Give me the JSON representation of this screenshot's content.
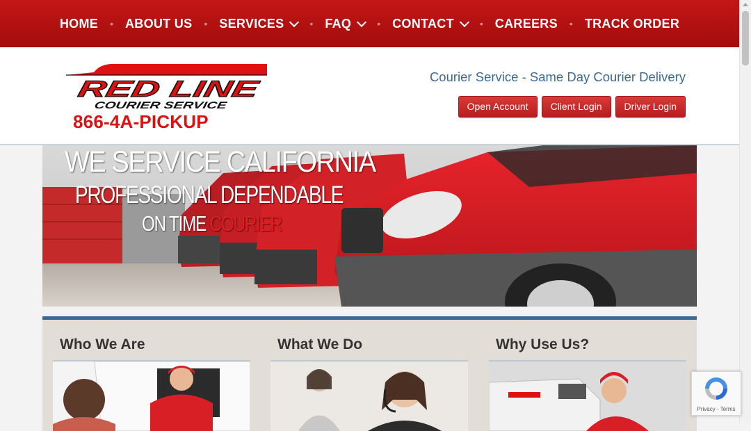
{
  "nav": {
    "items": [
      {
        "label": "HOME",
        "dropdown": false
      },
      {
        "label": "ABOUT US",
        "dropdown": false
      },
      {
        "label": "SERVICES",
        "dropdown": true
      },
      {
        "label": "FAQ",
        "dropdown": true
      },
      {
        "label": "CONTACT",
        "dropdown": true
      },
      {
        "label": "CAREERS",
        "dropdown": false
      },
      {
        "label": "TRACK ORDER",
        "dropdown": false
      }
    ],
    "separator": "•"
  },
  "logo": {
    "line1": "RED LINE",
    "line2": "COURIER SERVICE"
  },
  "header": {
    "phone": "866-4A-PICKUP",
    "tagline": "Courier Service - Same Day Courier Delivery",
    "buttons": [
      "Open Account",
      "Client Login",
      "Driver Login"
    ]
  },
  "hero": {
    "line1": "WE SERVICE CALIFORNIA",
    "line2": "PROFESSIONAL DEPENDABLE",
    "line3_prefix": "ON TIME ",
    "line3_highlight": "COURIER"
  },
  "columns": [
    {
      "title": "Who We Are"
    },
    {
      "title": "What We Do"
    },
    {
      "title": "Why Use Us?"
    }
  ],
  "recaptcha": {
    "links": "Privacy - Terms"
  },
  "colors": {
    "brand_red": "#c41616",
    "accent_blue": "#3d6896",
    "tagline_blue": "#3a6a96",
    "phone_red": "#e01010"
  }
}
